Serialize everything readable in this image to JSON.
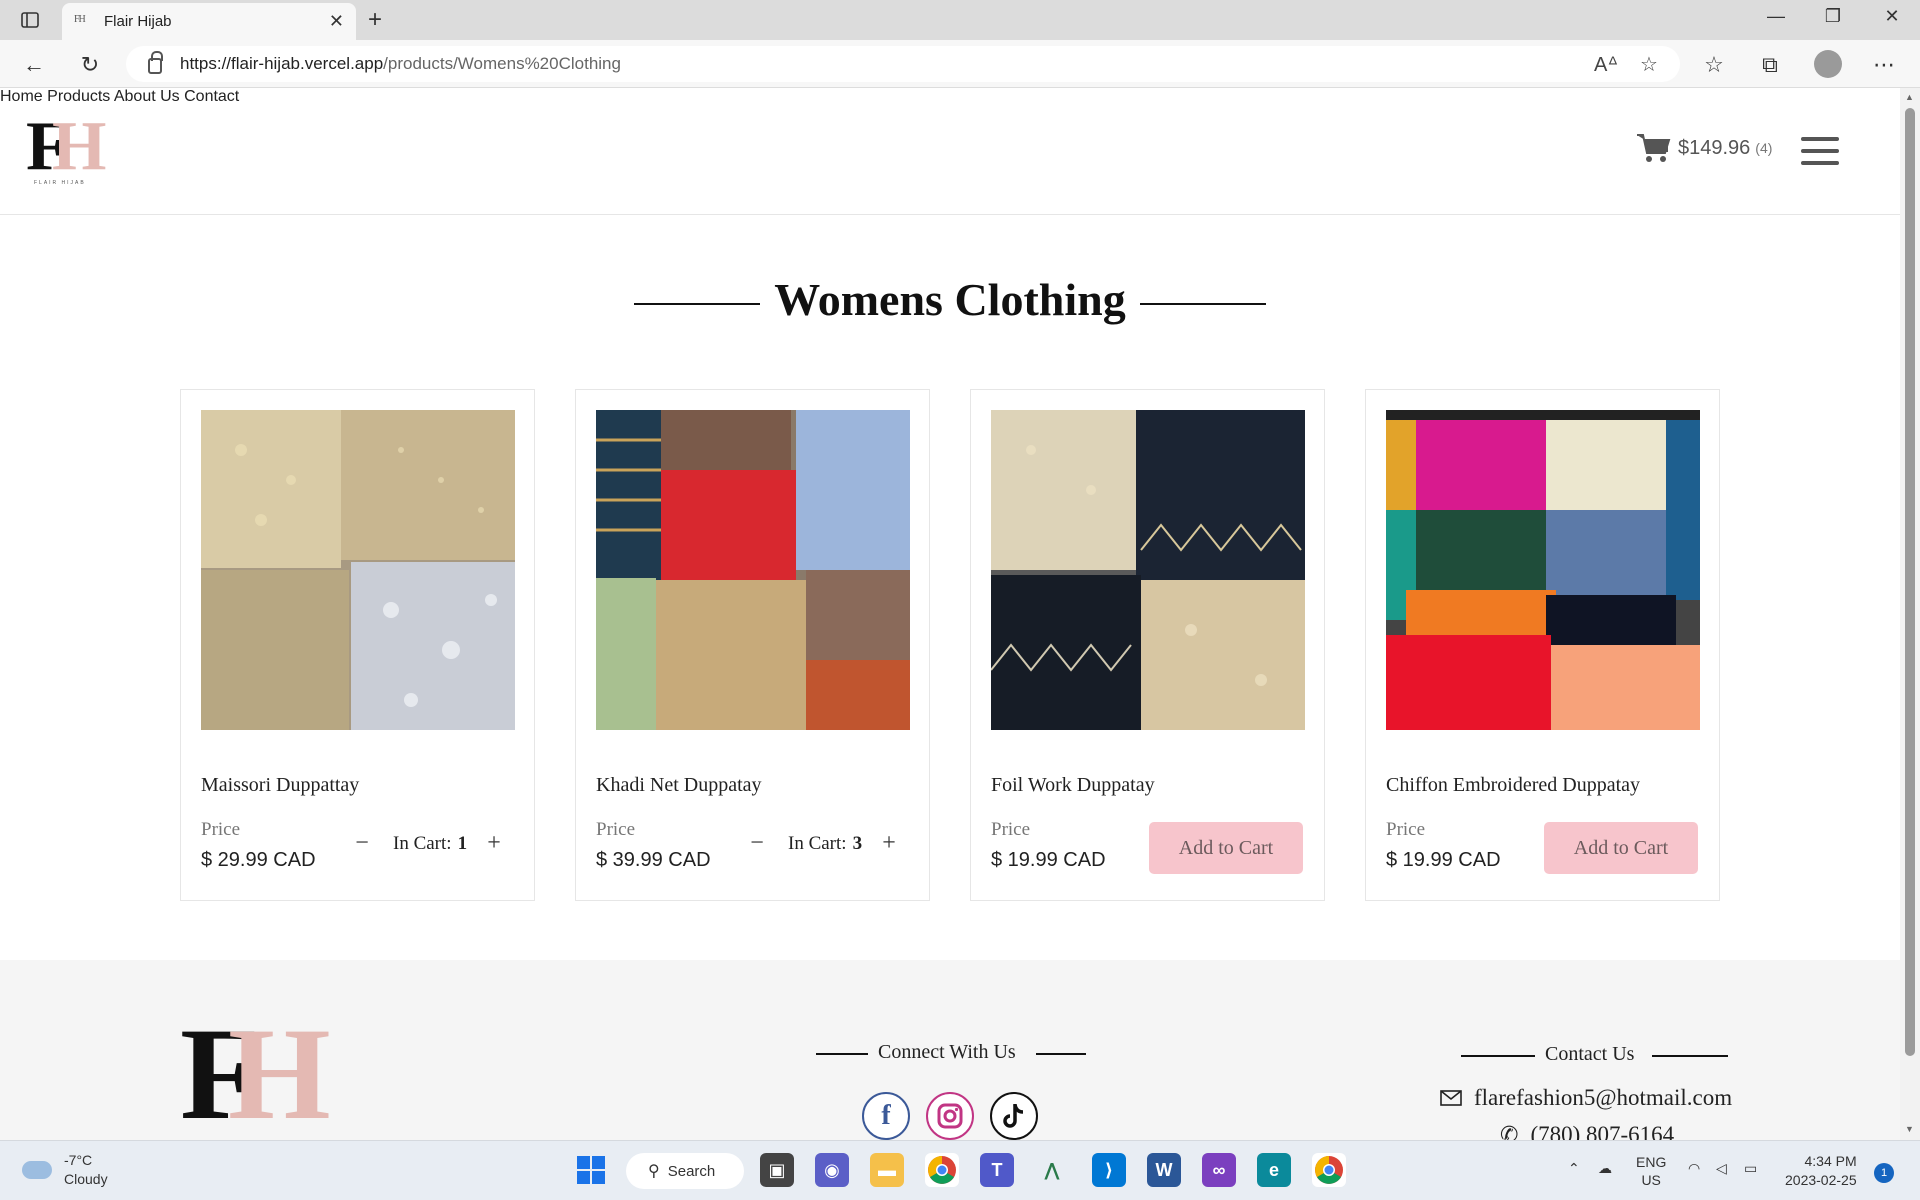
{
  "browser": {
    "tab_title": "Flair Hijab",
    "favicon_text": "FH",
    "url_host": "https://flair-hijab.vercel.app",
    "url_path": "/products/Womens%20Clothing"
  },
  "site": {
    "logo_sub": "FLAIR HIJAB",
    "nav": [
      "Home",
      "Products",
      "About Us",
      "Contact"
    ],
    "cart_total": "$149.96",
    "cart_count": "(4)"
  },
  "page": {
    "title": "Womens Clothing",
    "products": [
      {
        "name": "Maissori Duppattay",
        "price_label": "Price",
        "price": "$ 29.99 CAD",
        "in_cart_label": "In Cart:",
        "in_cart": "1",
        "action": null
      },
      {
        "name": "Khadi Net Duppatay",
        "price_label": "Price",
        "price": "$ 39.99 CAD",
        "in_cart_label": "In Cart:",
        "in_cart": "3",
        "action": null
      },
      {
        "name": "Foil Work Duppatay",
        "price_label": "Price",
        "price": "$ 19.99 CAD",
        "in_cart": null,
        "action": "Add to Cart"
      },
      {
        "name": "Chiffon Embroidered Duppatay",
        "price_label": "Price",
        "price": "$ 19.99 CAD",
        "in_cart": null,
        "action": "Add to Cart"
      }
    ]
  },
  "footer": {
    "connect_heading": "Connect With Us",
    "contact_heading": "Contact Us",
    "email": "flarefashion5@hotmail.com",
    "phone": "(780) 807-6164",
    "social": [
      "facebook-icon",
      "instagram-icon",
      "tiktok-icon"
    ]
  },
  "taskbar": {
    "temperature": "-7°C",
    "weather": "Cloudy",
    "search_label": "Search",
    "lang_top": "ENG",
    "lang_bottom": "US",
    "time": "4:34 PM",
    "date": "2023-02-25",
    "notification_count": "1"
  },
  "colors": {
    "accent_pink": "#f7c5cc",
    "logo_pink": "#e4b9b3",
    "footer_bg": "#f5f5f5"
  }
}
